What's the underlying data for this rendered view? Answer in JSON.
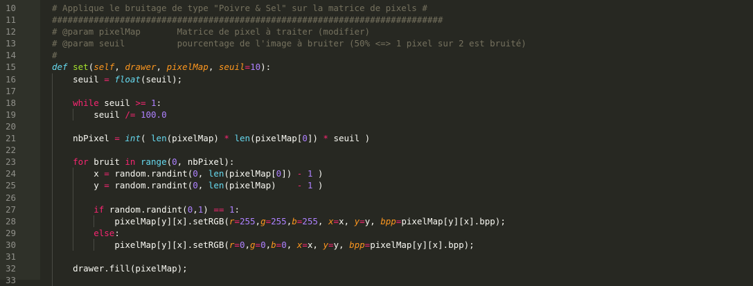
{
  "gutter": {
    "line_numbers": [
      "10",
      "11",
      "12",
      "13",
      "14",
      "15",
      "16",
      "17",
      "18",
      "19",
      "20",
      "21",
      "22",
      "23",
      "24",
      "25",
      "26",
      "27",
      "28",
      "29",
      "30",
      "31",
      "32",
      "33"
    ]
  },
  "lines": [
    {
      "indent": 0,
      "tokens": [
        {
          "t": "# Applique le bruitage de type \"Poivre & Sel\" sur la matrice de pixels #",
          "c": "c"
        }
      ]
    },
    {
      "indent": 0,
      "tokens": [
        {
          "t": "###########################################################################",
          "c": "c"
        }
      ]
    },
    {
      "indent": 0,
      "tokens": [
        {
          "t": "# @param pixelMap       Matrice de pixel à traiter (modifier)",
          "c": "c"
        }
      ]
    },
    {
      "indent": 0,
      "tokens": [
        {
          "t": "# @param seuil          pourcentage de l'image à bruiter (50% <=> 1 pixel sur 2 est bruité)",
          "c": "c"
        }
      ]
    },
    {
      "indent": 0,
      "tokens": [
        {
          "t": "#",
          "c": "c"
        }
      ]
    },
    {
      "indent": 0,
      "tokens": [
        {
          "t": "def ",
          "c": "d"
        },
        {
          "t": "set",
          "c": "f"
        },
        {
          "t": "(",
          "c": "t"
        },
        {
          "t": "self",
          "c": "p"
        },
        {
          "t": ", ",
          "c": "t"
        },
        {
          "t": "drawer",
          "c": "p"
        },
        {
          "t": ", ",
          "c": "t"
        },
        {
          "t": "pixelMap",
          "c": "p"
        },
        {
          "t": ", ",
          "c": "t"
        },
        {
          "t": "seuil",
          "c": "p"
        },
        {
          "t": "=",
          "c": "o"
        },
        {
          "t": "10",
          "c": "n"
        },
        {
          "t": "):",
          "c": "t"
        }
      ]
    },
    {
      "indent": 1,
      "tokens": [
        {
          "t": "seuil ",
          "c": "t"
        },
        {
          "t": "=",
          "c": "o"
        },
        {
          "t": " ",
          "c": "t"
        },
        {
          "t": "float",
          "c": "bi"
        },
        {
          "t": "(seuil);",
          "c": "t"
        }
      ]
    },
    {
      "indent": 1,
      "tokens": []
    },
    {
      "indent": 1,
      "tokens": [
        {
          "t": "while",
          "c": "k"
        },
        {
          "t": " seuil ",
          "c": "t"
        },
        {
          "t": ">=",
          "c": "o"
        },
        {
          "t": " ",
          "c": "t"
        },
        {
          "t": "1",
          "c": "n"
        },
        {
          "t": ":",
          "c": "t"
        }
      ]
    },
    {
      "indent": 2,
      "tokens": [
        {
          "t": "seuil ",
          "c": "t"
        },
        {
          "t": "/=",
          "c": "o"
        },
        {
          "t": " ",
          "c": "t"
        },
        {
          "t": "100.0",
          "c": "n"
        }
      ]
    },
    {
      "indent": 1,
      "tokens": []
    },
    {
      "indent": 1,
      "tokens": [
        {
          "t": "nbPixel ",
          "c": "t"
        },
        {
          "t": "=",
          "c": "o"
        },
        {
          "t": " ",
          "c": "t"
        },
        {
          "t": "int",
          "c": "bi"
        },
        {
          "t": "( ",
          "c": "t"
        },
        {
          "t": "len",
          "c": "b"
        },
        {
          "t": "(pixelMap) ",
          "c": "t"
        },
        {
          "t": "*",
          "c": "o"
        },
        {
          "t": " ",
          "c": "t"
        },
        {
          "t": "len",
          "c": "b"
        },
        {
          "t": "(pixelMap[",
          "c": "t"
        },
        {
          "t": "0",
          "c": "n"
        },
        {
          "t": "]) ",
          "c": "t"
        },
        {
          "t": "*",
          "c": "o"
        },
        {
          "t": " seuil )",
          "c": "t"
        }
      ]
    },
    {
      "indent": 1,
      "tokens": []
    },
    {
      "indent": 1,
      "tokens": [
        {
          "t": "for",
          "c": "k"
        },
        {
          "t": " bruit ",
          "c": "t"
        },
        {
          "t": "in",
          "c": "k"
        },
        {
          "t": " ",
          "c": "t"
        },
        {
          "t": "range",
          "c": "b"
        },
        {
          "t": "(",
          "c": "t"
        },
        {
          "t": "0",
          "c": "n"
        },
        {
          "t": ", nbPixel):",
          "c": "t"
        }
      ]
    },
    {
      "indent": 2,
      "tokens": [
        {
          "t": "x ",
          "c": "t"
        },
        {
          "t": "=",
          "c": "o"
        },
        {
          "t": " random.randint(",
          "c": "t"
        },
        {
          "t": "0",
          "c": "n"
        },
        {
          "t": ", ",
          "c": "t"
        },
        {
          "t": "len",
          "c": "b"
        },
        {
          "t": "(pixelMap[",
          "c": "t"
        },
        {
          "t": "0",
          "c": "n"
        },
        {
          "t": "]) ",
          "c": "t"
        },
        {
          "t": "-",
          "c": "o"
        },
        {
          "t": " ",
          "c": "t"
        },
        {
          "t": "1",
          "c": "n"
        },
        {
          "t": " )",
          "c": "t"
        }
      ]
    },
    {
      "indent": 2,
      "tokens": [
        {
          "t": "y ",
          "c": "t"
        },
        {
          "t": "=",
          "c": "o"
        },
        {
          "t": " random.randint(",
          "c": "t"
        },
        {
          "t": "0",
          "c": "n"
        },
        {
          "t": ", ",
          "c": "t"
        },
        {
          "t": "len",
          "c": "b"
        },
        {
          "t": "(pixelMap)    ",
          "c": "t"
        },
        {
          "t": "-",
          "c": "o"
        },
        {
          "t": " ",
          "c": "t"
        },
        {
          "t": "1",
          "c": "n"
        },
        {
          "t": " )",
          "c": "t"
        }
      ]
    },
    {
      "indent": 2,
      "tokens": []
    },
    {
      "indent": 2,
      "tokens": [
        {
          "t": "if",
          "c": "k"
        },
        {
          "t": " random.randint(",
          "c": "t"
        },
        {
          "t": "0",
          "c": "n"
        },
        {
          "t": ",",
          "c": "t"
        },
        {
          "t": "1",
          "c": "n"
        },
        {
          "t": ") ",
          "c": "t"
        },
        {
          "t": "==",
          "c": "o"
        },
        {
          "t": " ",
          "c": "t"
        },
        {
          "t": "1",
          "c": "n"
        },
        {
          "t": ":",
          "c": "t"
        }
      ]
    },
    {
      "indent": 3,
      "tokens": [
        {
          "t": "pixelMap[y][x].setRGB(",
          "c": "t"
        },
        {
          "t": "r",
          "c": "p"
        },
        {
          "t": "=",
          "c": "o"
        },
        {
          "t": "255",
          "c": "n"
        },
        {
          "t": ",",
          "c": "t"
        },
        {
          "t": "g",
          "c": "p"
        },
        {
          "t": "=",
          "c": "o"
        },
        {
          "t": "255",
          "c": "n"
        },
        {
          "t": ",",
          "c": "t"
        },
        {
          "t": "b",
          "c": "p"
        },
        {
          "t": "=",
          "c": "o"
        },
        {
          "t": "255",
          "c": "n"
        },
        {
          "t": ", ",
          "c": "t"
        },
        {
          "t": "x",
          "c": "p"
        },
        {
          "t": "=",
          "c": "o"
        },
        {
          "t": "x, ",
          "c": "t"
        },
        {
          "t": "y",
          "c": "p"
        },
        {
          "t": "=",
          "c": "o"
        },
        {
          "t": "y, ",
          "c": "t"
        },
        {
          "t": "bpp",
          "c": "p"
        },
        {
          "t": "=",
          "c": "o"
        },
        {
          "t": "pixelMap[y][x].bpp);",
          "c": "t"
        }
      ]
    },
    {
      "indent": 2,
      "tokens": [
        {
          "t": "else",
          "c": "k"
        },
        {
          "t": ":",
          "c": "t"
        }
      ]
    },
    {
      "indent": 3,
      "tokens": [
        {
          "t": "pixelMap[y][x].setRGB(",
          "c": "t"
        },
        {
          "t": "r",
          "c": "p"
        },
        {
          "t": "=",
          "c": "o"
        },
        {
          "t": "0",
          "c": "n"
        },
        {
          "t": ",",
          "c": "t"
        },
        {
          "t": "g",
          "c": "p"
        },
        {
          "t": "=",
          "c": "o"
        },
        {
          "t": "0",
          "c": "n"
        },
        {
          "t": ",",
          "c": "t"
        },
        {
          "t": "b",
          "c": "p"
        },
        {
          "t": "=",
          "c": "o"
        },
        {
          "t": "0",
          "c": "n"
        },
        {
          "t": ", ",
          "c": "t"
        },
        {
          "t": "x",
          "c": "p"
        },
        {
          "t": "=",
          "c": "o"
        },
        {
          "t": "x, ",
          "c": "t"
        },
        {
          "t": "y",
          "c": "p"
        },
        {
          "t": "=",
          "c": "o"
        },
        {
          "t": "y, ",
          "c": "t"
        },
        {
          "t": "bpp",
          "c": "p"
        },
        {
          "t": "=",
          "c": "o"
        },
        {
          "t": "pixelMap[y][x].bpp);",
          "c": "t"
        }
      ]
    },
    {
      "indent": 1,
      "tokens": []
    },
    {
      "indent": 1,
      "tokens": [
        {
          "t": "drawer.fill(pixelMap);",
          "c": "t"
        }
      ]
    },
    {
      "indent": 1,
      "tokens": []
    }
  ]
}
